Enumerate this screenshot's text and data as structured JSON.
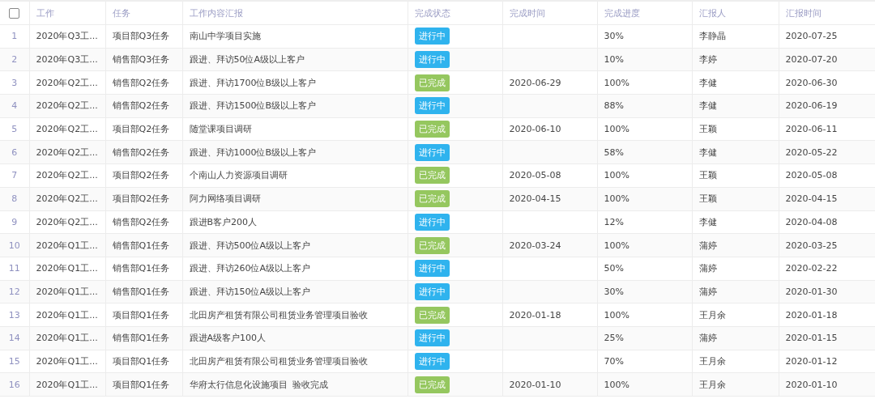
{
  "table": {
    "select_all": {
      "checked": false
    },
    "columns": [
      "工作",
      "任务",
      "工作内容汇报",
      "完成状态",
      "完成时间",
      "完成进度",
      "汇报人",
      "汇报时间"
    ],
    "rows": [
      {
        "index": "1",
        "work": "2020年Q3工...",
        "task": "项目部Q3任务",
        "report": "南山中学项目实施",
        "status": {
          "kind": "in_progress",
          "label": "进行中"
        },
        "done_time": "",
        "progress": "30%",
        "reporter": "李静晶",
        "report_time": "2020-07-25"
      },
      {
        "index": "2",
        "work": "2020年Q3工...",
        "task": "销售部Q3任务",
        "report": "跟进、拜访50位A级以上客户",
        "status": {
          "kind": "in_progress",
          "label": "进行中"
        },
        "done_time": "",
        "progress": "10%",
        "reporter": "李婷",
        "report_time": "2020-07-20"
      },
      {
        "index": "3",
        "work": "2020年Q2工...",
        "task": "销售部Q2任务",
        "report": "跟进、拜访1700位B级以上客户",
        "status": {
          "kind": "done",
          "label": "已完成"
        },
        "done_time": "2020-06-29",
        "progress": "100%",
        "reporter": "李健",
        "report_time": "2020-06-30"
      },
      {
        "index": "4",
        "work": "2020年Q2工...",
        "task": "销售部Q2任务",
        "report": "跟进、拜访1500位B级以上客户",
        "status": {
          "kind": "in_progress",
          "label": "进行中"
        },
        "done_time": "",
        "progress": "88%",
        "reporter": "李健",
        "report_time": "2020-06-19"
      },
      {
        "index": "5",
        "work": "2020年Q2工...",
        "task": "项目部Q2任务",
        "report": "随堂课项目调研",
        "status": {
          "kind": "done",
          "label": "已完成"
        },
        "done_time": "2020-06-10",
        "progress": "100%",
        "reporter": "王颖",
        "report_time": "2020-06-11"
      },
      {
        "index": "6",
        "work": "2020年Q2工...",
        "task": "销售部Q2任务",
        "report": "跟进、拜访1000位B级以上客户",
        "status": {
          "kind": "in_progress",
          "label": "进行中"
        },
        "done_time": "",
        "progress": "58%",
        "reporter": "李健",
        "report_time": "2020-05-22"
      },
      {
        "index": "7",
        "work": "2020年Q2工...",
        "task": "项目部Q2任务",
        "report": "个南山人力资源项目调研",
        "status": {
          "kind": "done",
          "label": "已完成"
        },
        "done_time": "2020-05-08",
        "progress": "100%",
        "reporter": "王颖",
        "report_time": "2020-05-08"
      },
      {
        "index": "8",
        "work": "2020年Q2工...",
        "task": "项目部Q2任务",
        "report": "阿力网络项目调研",
        "status": {
          "kind": "done",
          "label": "已完成"
        },
        "done_time": "2020-04-15",
        "progress": "100%",
        "reporter": "王颖",
        "report_time": "2020-04-15"
      },
      {
        "index": "9",
        "work": "2020年Q2工...",
        "task": "销售部Q2任务",
        "report": "跟进B客户200人",
        "status": {
          "kind": "in_progress",
          "label": "进行中"
        },
        "done_time": "",
        "progress": "12%",
        "reporter": "李健",
        "report_time": "2020-04-08"
      },
      {
        "index": "10",
        "work": "2020年Q1工...",
        "task": "销售部Q1任务",
        "report": "跟进、拜访500位A级以上客户",
        "status": {
          "kind": "done",
          "label": "已完成"
        },
        "done_time": "2020-03-24",
        "progress": "100%",
        "reporter": "蒲婷",
        "report_time": "2020-03-25"
      },
      {
        "index": "11",
        "work": "2020年Q1工...",
        "task": "销售部Q1任务",
        "report": "跟进、拜访260位A级以上客户",
        "status": {
          "kind": "in_progress",
          "label": "进行中"
        },
        "done_time": "",
        "progress": "50%",
        "reporter": "蒲婷",
        "report_time": "2020-02-22"
      },
      {
        "index": "12",
        "work": "2020年Q1工...",
        "task": "销售部Q1任务",
        "report": "跟进、拜访150位A级以上客户",
        "status": {
          "kind": "in_progress",
          "label": "进行中"
        },
        "done_time": "",
        "progress": "30%",
        "reporter": "蒲婷",
        "report_time": "2020-01-30"
      },
      {
        "index": "13",
        "work": "2020年Q1工...",
        "task": "项目部Q1任务",
        "report": "北田房产租赁有限公司租赁业务管理项目验收",
        "status": {
          "kind": "done",
          "label": "已完成"
        },
        "done_time": "2020-01-18",
        "progress": "100%",
        "reporter": "王月余",
        "report_time": "2020-01-18"
      },
      {
        "index": "14",
        "work": "2020年Q1工...",
        "task": "销售部Q1任务",
        "report": "跟进A级客户100人",
        "status": {
          "kind": "in_progress",
          "label": "进行中"
        },
        "done_time": "",
        "progress": "25%",
        "reporter": "蒲婷",
        "report_time": "2020-01-15"
      },
      {
        "index": "15",
        "work": "2020年Q1工...",
        "task": "项目部Q1任务",
        "report": "北田房产租赁有限公司租赁业务管理项目验收",
        "status": {
          "kind": "in_progress",
          "label": "进行中"
        },
        "done_time": "",
        "progress": "70%",
        "reporter": "王月余",
        "report_time": "2020-01-12"
      },
      {
        "index": "16",
        "work": "2020年Q1工...",
        "task": "项目部Q1任务",
        "report": "华府太行信息化设施项目  验收完成",
        "status": {
          "kind": "done",
          "label": "已完成"
        },
        "done_time": "2020-01-10",
        "progress": "100%",
        "reporter": "王月余",
        "report_time": "2020-01-10"
      }
    ]
  }
}
